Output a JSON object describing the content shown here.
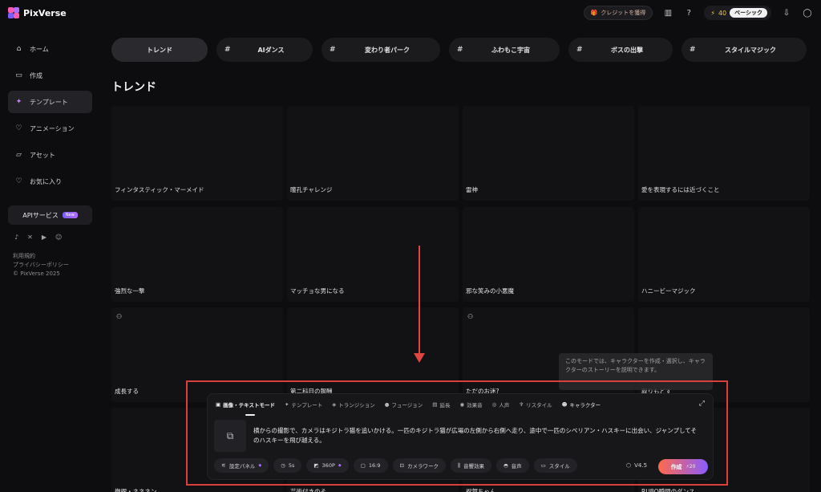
{
  "header": {
    "logo": "PixVerse",
    "credit_button": "クレジットを獲得",
    "energy": "40",
    "plan": "ベーシック",
    "colors": {
      "accent": "#f0c840"
    }
  },
  "sidebar": {
    "items": [
      {
        "label": "ホーム",
        "icon": "home-icon"
      },
      {
        "label": "作成",
        "icon": "video-icon"
      },
      {
        "label": "テンプレート",
        "icon": "sparkle-icon"
      },
      {
        "label": "アニメーション",
        "icon": "fox-icon"
      },
      {
        "label": "アセット",
        "icon": "folder-icon"
      },
      {
        "label": "お気に入り",
        "icon": "heart-icon"
      }
    ],
    "api": {
      "label": "APIサービス",
      "badge": "New"
    },
    "footer": {
      "terms": "利用規約",
      "privacy": "プライバシーポリシー",
      "copyright": "© PixVerse 2025"
    }
  },
  "tabs": [
    {
      "label": "トレンド"
    },
    {
      "label": "AIダンス"
    },
    {
      "label": "変わり者パーク"
    },
    {
      "label": "ふわもこ宇宙"
    },
    {
      "label": "ボスの出撃"
    },
    {
      "label": "スタイルマジック"
    }
  ],
  "section_title": "トレンド",
  "cards": [
    "フィンタスティック・マーメイド",
    "瞳孔チャレンジ",
    "雷神",
    "愛を表現するには近づくこと",
    "強烈な一撃",
    "マッチョな男になる",
    "邪な笑みの小悪魔",
    "ハニービーマジック",
    "成長する",
    "第二科目の報酬",
    "ただのお迷?",
    "取りもどす",
    "撫摺・ネネネン",
    "芸術付きのそ",
    "祝賀ちゃん",
    "RUBO瞬間のダンス"
  ],
  "tooltip": "このモードでは、キャラクターを作成・選択し、キャラクターのストーリーを説明できます。",
  "composer": {
    "modes": [
      {
        "label": "画像・テキストモード",
        "icon": "image-icon"
      },
      {
        "label": "テンプレート",
        "icon": "sparkle-icon"
      },
      {
        "label": "トランジション",
        "icon": "magic-icon"
      },
      {
        "label": "フュージョン",
        "icon": "fusion-icon"
      },
      {
        "label": "延長",
        "icon": "extend-icon"
      },
      {
        "label": "効果音",
        "icon": "sound-icon"
      },
      {
        "label": "人声",
        "icon": "voice-icon"
      },
      {
        "label": "リスタイル",
        "icon": "brush-icon"
      },
      {
        "label": "キャラクター",
        "icon": "character-icon"
      }
    ],
    "prompt": "横からの撮影で、カメラはキジトラ猫を追いかける。一匹のキジトラ猫が広場の左側から右側へ走り、途中で一匹のシベリアン・ハスキーに出会い、ジャンプしてそのハスキーを飛び越える。",
    "options": [
      {
        "label": "設定パネル",
        "icon": "sliders-icon"
      },
      {
        "label": "5s",
        "icon": "clock-icon"
      },
      {
        "label": "360P",
        "icon": "resolution-icon"
      },
      {
        "label": "16:9",
        "icon": "aspect-icon"
      },
      {
        "label": "カメラワーク",
        "icon": "camera-icon"
      },
      {
        "label": "音響効果",
        "icon": "wave-icon"
      },
      {
        "label": "音声",
        "icon": "lips-icon"
      },
      {
        "label": "スタイル",
        "icon": "style-icon"
      }
    ],
    "version": "V4.5",
    "create_label": "作成",
    "create_cost": "20"
  }
}
